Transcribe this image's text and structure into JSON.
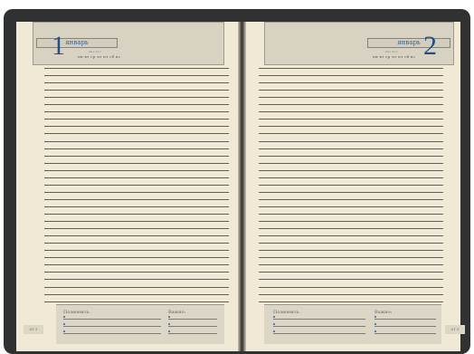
{
  "left_page": {
    "month": "январь",
    "weekdays": "пн вт ср чт пт сб вс",
    "week_marks": "пн-т   вт-т",
    "page_number": "1",
    "footer": {
      "remember_label": "Позвонить:",
      "important_label": "Важно:"
    },
    "side_tab": "01.1"
  },
  "right_page": {
    "month": "январь",
    "weekdays": "пн вт ср чт пт сб вс",
    "week_marks": "пн-т   вт-т",
    "page_number": "2",
    "footer": {
      "remember_label": "Позвонить:",
      "important_label": "Важно:"
    },
    "side_tab": "01.1"
  }
}
